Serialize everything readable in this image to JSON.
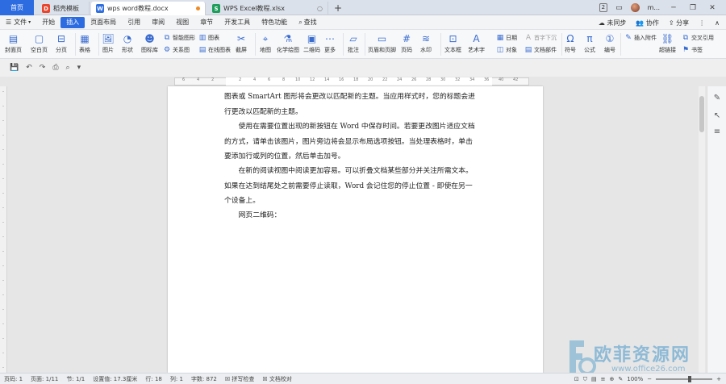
{
  "titlebar": {
    "home_tab": "首页",
    "tabs": [
      {
        "label": "稻壳模板",
        "icon_color": "#e8452c",
        "icon_char": "D"
      },
      {
        "label": "wps word教程.docx",
        "icon_color": "#2f6fe0",
        "icon_char": "W"
      },
      {
        "label": "WPS Excel教程.xlsx",
        "icon_color": "#1e9e5a",
        "icon_char": "S"
      }
    ],
    "notif_count": "2",
    "username": "m..."
  },
  "menubar": {
    "file": "文件",
    "items": [
      "开始",
      "插入",
      "页面布局",
      "引用",
      "审阅",
      "视图",
      "章节",
      "开发工具",
      "特色功能"
    ],
    "active": "插入",
    "search": "查找",
    "right": [
      "未同步",
      "协作",
      "分享"
    ]
  },
  "ribbon": {
    "cover_page": "封面页",
    "blank_page": "空白页",
    "page_break": "分页",
    "table": "表格",
    "picture": "图片",
    "shape": "形状",
    "icon_lib": "图标库",
    "smart_graphic": "智能图形",
    "chart": "图表",
    "relation_graph": "关系图",
    "online_chart": "在线图表",
    "screenshot": "截屏",
    "map": "地图",
    "chem_drawing": "化学绘图",
    "qr_code": "二维码",
    "more": "更多",
    "comment": "批注",
    "header_footer": "页眉和页脚",
    "page_number": "页码",
    "watermark": "水印",
    "text_box": "文本框",
    "art_text": "艺术字",
    "date": "日期",
    "drop_cap": "首字下沉",
    "object": "对象",
    "doc_parts": "文档部件",
    "symbol": "符号",
    "formula": "公式",
    "numbering": "编号",
    "attachment": "插入附件",
    "hyperlink": "超链接",
    "cross_ref": "交叉引用",
    "bookmark": "书签"
  },
  "document": {
    "paragraphs": [
      {
        "lines": [
          "图表或 SmartArt 图形将会更改以匹配新的主题。当应用样式时，您的标题会进",
          "行更改以匹配新的主题。"
        ]
      },
      {
        "lines": [
          "　　使用在需要位置出现的新按钮在 Word 中保存时间。若要更改图片适应文档",
          "的方式，请单击该图片，图片旁边将会显示布局选项按钮。当处理表格时，单击",
          "要添加行或列的位置，然后单击加号。"
        ]
      },
      {
        "lines": [
          "　　在新的阅读视图中阅读更加容易。可以折叠文档某些部分并关注所需文本。",
          "如果在达到结尾处之前需要停止读取，Word 会记住您的停止位置 - 即使在另一",
          "个设备上。"
        ]
      },
      {
        "lines": [
          "　　网页二维码："
        ]
      }
    ]
  },
  "statusbar": {
    "page_num": "页码: 1",
    "page_of": "页面: 1/11",
    "section": "节: 1/1",
    "setting": "设置值: 17.3厘米",
    "row": "行: 18",
    "col": "列: 1",
    "word_count": "字数: 872",
    "spell_check": "拼写检查",
    "doc_proof": "文档校对",
    "zoom": "100%"
  },
  "watermark": {
    "title": "欧菲资源网",
    "subtitle": "www.office26.com"
  }
}
